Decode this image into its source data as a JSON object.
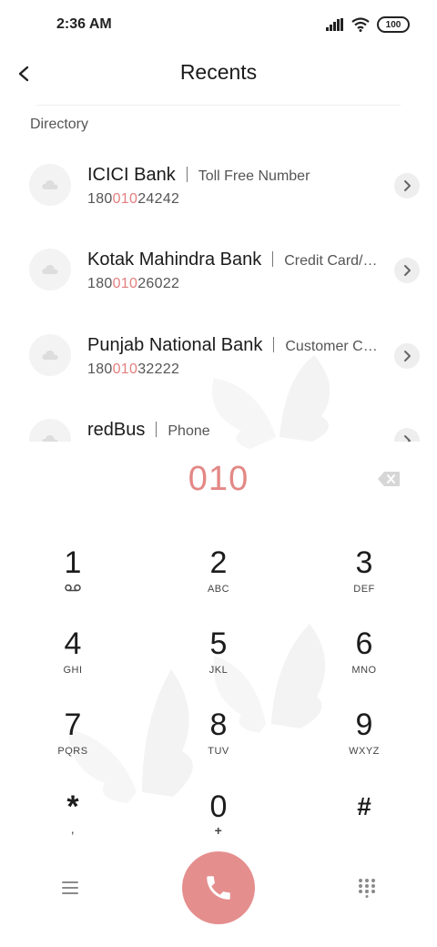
{
  "status_bar": {
    "time": "2:36 AM",
    "battery": "100"
  },
  "header": {
    "title": "Recents"
  },
  "section": {
    "label": "Directory"
  },
  "results": [
    {
      "name": "ICICI Bank",
      "desc": "Toll Free Number",
      "num_prefix": "180",
      "num_match": "010",
      "num_suffix": "24242"
    },
    {
      "name": "Kotak Mahindra Bank",
      "desc": "Credit Card/…",
      "num_prefix": "180",
      "num_match": "010",
      "num_suffix": "26022"
    },
    {
      "name": "Punjab National Bank",
      "desc": "Customer C…",
      "num_prefix": "180",
      "num_match": "010",
      "num_suffix": "32222"
    },
    {
      "name": "redBus",
      "desc": "Phone",
      "num_prefix": "",
      "num_match": "",
      "num_suffix": ""
    }
  ],
  "dialer": {
    "input": "010"
  },
  "keypad": [
    {
      "digit": "1",
      "letters": ""
    },
    {
      "digit": "2",
      "letters": "ABC"
    },
    {
      "digit": "3",
      "letters": "DEF"
    },
    {
      "digit": "4",
      "letters": "GHI"
    },
    {
      "digit": "5",
      "letters": "JKL"
    },
    {
      "digit": "6",
      "letters": "MNO"
    },
    {
      "digit": "7",
      "letters": "PQRS"
    },
    {
      "digit": "8",
      "letters": "TUV"
    },
    {
      "digit": "9",
      "letters": "WXYZ"
    },
    {
      "digit": "*",
      "letters": ","
    },
    {
      "digit": "0",
      "letters": "+"
    },
    {
      "digit": "#",
      "letters": ""
    }
  ],
  "colors": {
    "accent": "#e58e8e",
    "highlight": "#e37f7f"
  },
  "icons": {
    "back": "chevron-left-icon",
    "avatar": "cloud-icon",
    "detail": "chevron-right-icon",
    "backspace": "backspace-icon",
    "voicemail": "voicemail-icon",
    "menu": "menu-icon",
    "call": "phone-icon",
    "keypad": "dialpad-icon"
  }
}
